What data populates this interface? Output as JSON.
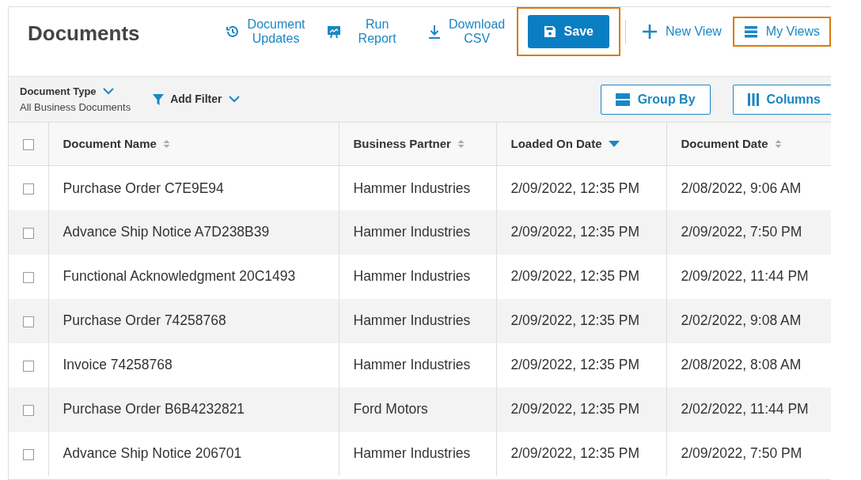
{
  "header": {
    "title": "Documents",
    "actions": [
      {
        "kind": "history",
        "label": "Document Updates",
        "highlighted": false
      },
      {
        "kind": "report",
        "label": "Run Report",
        "highlighted": false
      },
      {
        "kind": "download",
        "label": "Download CSV",
        "highlighted": false
      },
      {
        "kind": "save",
        "label": "Save",
        "highlighted": true
      },
      {
        "kind": "divider"
      },
      {
        "kind": "plus",
        "label": "New View",
        "highlighted": false
      },
      {
        "kind": "menu",
        "label": "My Views",
        "highlighted": true
      }
    ]
  },
  "filters": {
    "document_type": {
      "label": "Document Type",
      "value": "All Business Documents"
    },
    "add_filter": "Add Filter",
    "group_by": "Group By",
    "columns": "Columns"
  },
  "table": {
    "select_all_checked": false,
    "columns": [
      {
        "label": "Document Name",
        "sorted": false
      },
      {
        "label": "Business Partner",
        "sorted": false
      },
      {
        "label": "Loaded On Date",
        "sorted": true
      },
      {
        "label": "Document Date",
        "sorted": false
      }
    ],
    "rows": [
      {
        "checked": false,
        "cells": [
          "Purchase Order C7E9E94",
          "Hammer Industries",
          "2/09/2022, 12:35 PM",
          "2/08/2022, 9:06 AM"
        ]
      },
      {
        "checked": false,
        "cells": [
          "Advance Ship Notice A7D238B39",
          "Hammer Industries",
          "2/09/2022, 12:35 PM",
          "2/09/2022, 7:50 PM"
        ]
      },
      {
        "checked": false,
        "cells": [
          "Functional Acknowledgment 20C1493",
          "Hammer Industries",
          "2/09/2022, 12:35 PM",
          "2/09/2022, 11:44 PM"
        ]
      },
      {
        "checked": false,
        "cells": [
          "Purchase Order 74258768",
          "Hammer Industries",
          "2/09/2022, 12:35 PM",
          "2/02/2022, 9:08 AM"
        ]
      },
      {
        "checked": false,
        "cells": [
          "Invoice 74258768",
          "Hammer Industries",
          "2/09/2022, 12:35 PM",
          "2/08/2022, 8:08 AM"
        ]
      },
      {
        "checked": false,
        "cells": [
          "Purchase Order B6B4232821",
          "Ford Motors",
          "2/09/2022, 12:35 PM",
          "2/02/2022, 11:44 PM"
        ]
      },
      {
        "checked": false,
        "cells": [
          "Advance Ship Notice 206701",
          "Hammer Industries",
          "2/09/2022, 12:35 PM",
          "2/09/2022, 7:50 PM"
        ]
      }
    ]
  }
}
